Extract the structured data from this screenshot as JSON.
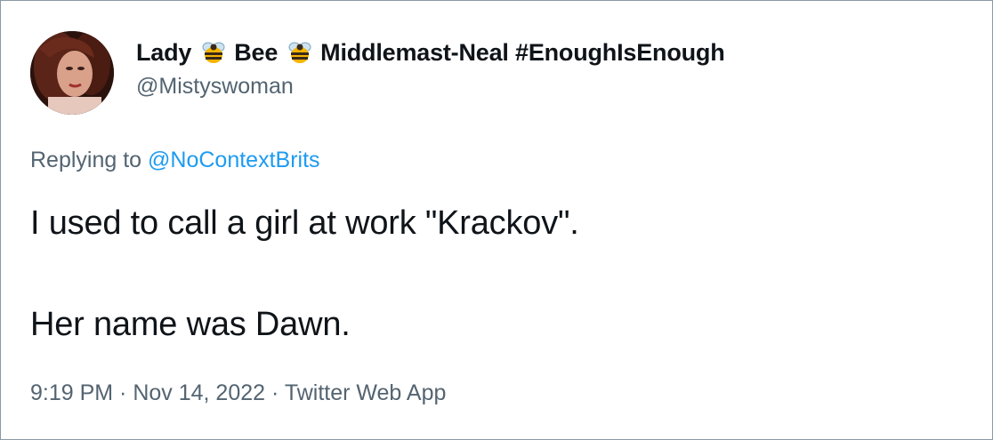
{
  "tweet": {
    "author": {
      "display_name_parts": [
        "Lady",
        "Bee",
        "Middlemast-Neal #EnoughIsEnough"
      ],
      "name_icon": "bee-icon",
      "handle": "@Mistyswoman"
    },
    "reply": {
      "prefix": "Replying to ",
      "mention": "@NoContextBrits"
    },
    "text_lines": [
      "I used to call a girl at work \"Krackov\".",
      "Her name was Dawn."
    ],
    "meta": {
      "time": "9:19 PM",
      "separator": " · ",
      "date": "Nov 14, 2022",
      "source": "Twitter Web App"
    }
  },
  "colors": {
    "text_primary": "#0f1419",
    "text_secondary": "#536471",
    "link": "#1d9bf0",
    "border": "#8b98a5"
  }
}
